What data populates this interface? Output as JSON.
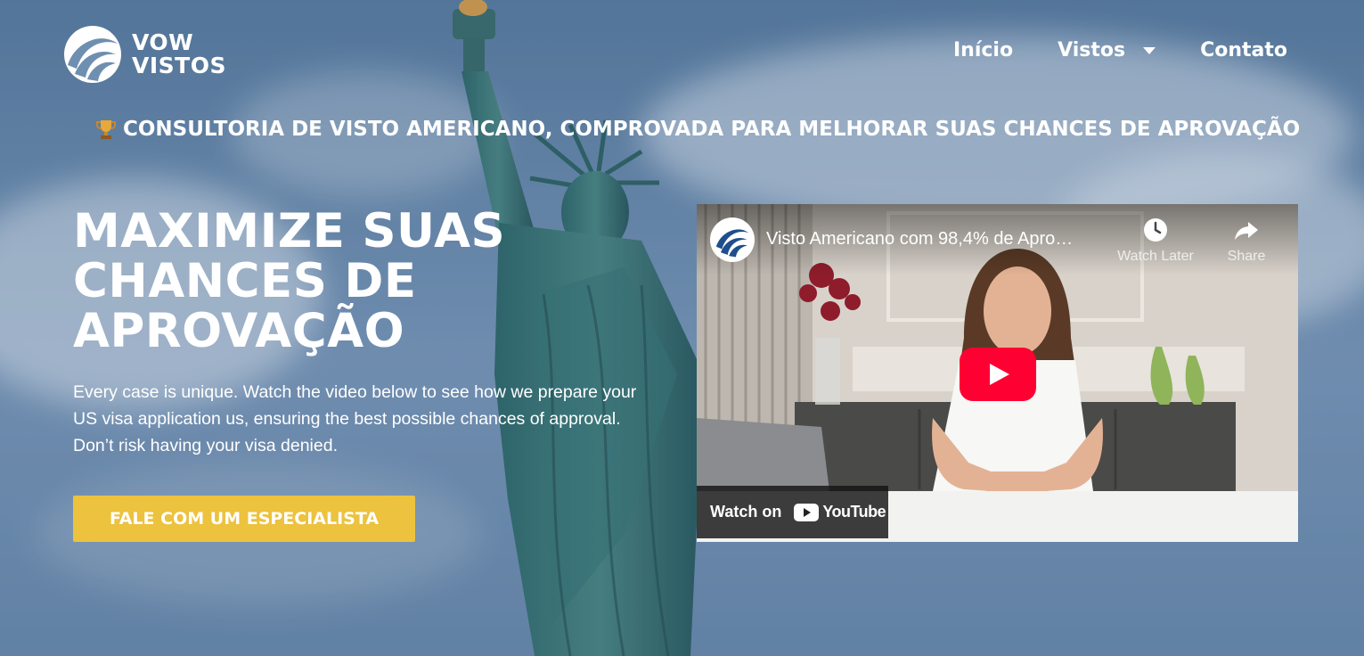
{
  "header": {
    "logo_line1": "VOW",
    "logo_line2": "VISTOS",
    "nav": {
      "home": "Início",
      "visas": "Vistos",
      "contact": "Contato"
    }
  },
  "tagline": {
    "icon": "trophy-icon",
    "text": "CONSULTORIA DE VISTO AMERICANO, COMPROVADA PARA MELHORAR SUAS CHANCES DE APROVAÇÃO"
  },
  "hero": {
    "title_lines": [
      "MAXIMIZE SUAS",
      "CHANCES DE",
      "APROVAÇÃO"
    ],
    "text": "Every case is unique. Watch the video below to see how we prepare your US visa application us, ensuring the best possible chances of approval. Don’t risk having your visa denied.",
    "cta_label": "FALE COM UM ESPECIALISTA"
  },
  "video": {
    "title": "Visto Americano com 98,4% de Apro…",
    "watch_later_label": "Watch Later",
    "share_label": "Share",
    "watch_on_label": "Watch on",
    "youtube_label": "YouTube"
  },
  "colors": {
    "cta_bg": "#ecc23e",
    "youtube_red": "#ff0033",
    "sky": "#6f8fb1"
  }
}
